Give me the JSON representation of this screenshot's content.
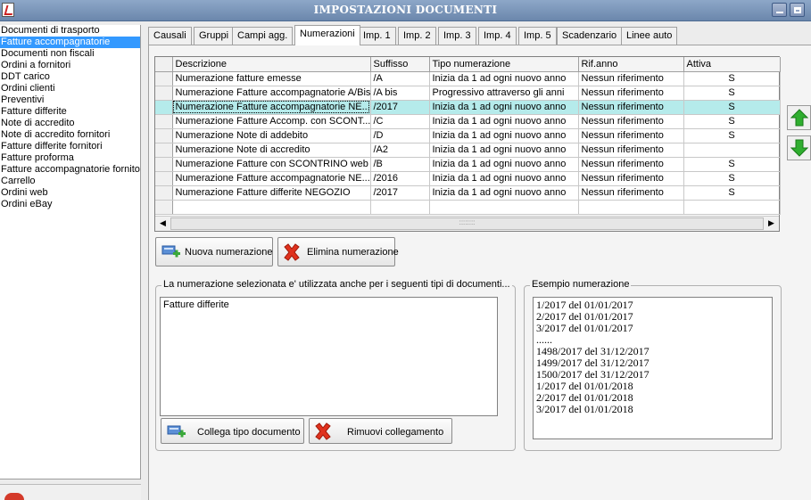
{
  "window": {
    "title": "IMPOSTAZIONI DOCUMENTI"
  },
  "sidebar": {
    "items": [
      {
        "label": "Documenti di trasporto",
        "selected": false
      },
      {
        "label": "Fatture accompagnatorie",
        "selected": true
      },
      {
        "label": "Documenti non fiscali",
        "selected": false
      },
      {
        "label": "Ordini a fornitori",
        "selected": false
      },
      {
        "label": "DDT carico",
        "selected": false
      },
      {
        "label": "Ordini clienti",
        "selected": false
      },
      {
        "label": "Preventivi",
        "selected": false
      },
      {
        "label": "Fatture differite",
        "selected": false
      },
      {
        "label": "Note di accredito",
        "selected": false
      },
      {
        "label": "Note di accredito fornitori",
        "selected": false
      },
      {
        "label": "Fatture differite fornitori",
        "selected": false
      },
      {
        "label": "Fatture proforma",
        "selected": false
      },
      {
        "label": "Fatture accompagnatorie fornito",
        "selected": false
      },
      {
        "label": "Carrello",
        "selected": false
      },
      {
        "label": "Ordini web",
        "selected": false
      },
      {
        "label": "Ordini eBay",
        "selected": false
      }
    ]
  },
  "tabs": [
    {
      "label": "Causali",
      "active": false
    },
    {
      "label": "Gruppi",
      "active": false
    },
    {
      "label": "Campi agg.",
      "active": false
    },
    {
      "label": "Numerazioni",
      "active": true
    },
    {
      "label": "Imp. 1",
      "active": false
    },
    {
      "label": "Imp. 2",
      "active": false
    },
    {
      "label": "Imp. 3",
      "active": false
    },
    {
      "label": "Imp. 4",
      "active": false
    },
    {
      "label": "Imp. 5",
      "active": false
    },
    {
      "label": "Scadenzario",
      "active": false
    },
    {
      "label": "Linee auto",
      "active": false
    }
  ],
  "grid": {
    "columns": [
      "Descrizione",
      "Suffisso",
      "Tipo numerazione",
      "Rif.anno",
      "Attiva"
    ],
    "rows": [
      {
        "desc": "Numerazione fatture emesse",
        "suffix": "/A",
        "type": "Inizia da 1 ad ogni nuovo anno",
        "rif": "Nessun riferimento",
        "active": "S",
        "selected": false
      },
      {
        "desc": "Numerazione Fatture accompagnatorie A/Bis",
        "suffix": "/A bis",
        "type": "Progressivo attraverso gli anni",
        "rif": "Nessun riferimento",
        "active": "S",
        "selected": false
      },
      {
        "desc": "Numerazione Fatture accompagnatorie NE...",
        "suffix": "/2017",
        "type": "Inizia da 1 ad ogni nuovo anno",
        "rif": "Nessun riferimento",
        "active": "S",
        "selected": true
      },
      {
        "desc": "Numerazione Fatture Accomp. con SCONT...",
        "suffix": "/C",
        "type": "Inizia da 1 ad ogni nuovo anno",
        "rif": "Nessun riferimento",
        "active": "S",
        "selected": false
      },
      {
        "desc": "Numerazione Note di addebito",
        "suffix": "/D",
        "type": "Inizia da 1 ad ogni nuovo anno",
        "rif": "Nessun riferimento",
        "active": "S",
        "selected": false
      },
      {
        "desc": "Numerazione Note di accredito",
        "suffix": "/A2",
        "type": "Inizia da 1 ad ogni nuovo anno",
        "rif": "Nessun riferimento",
        "active": "",
        "selected": false
      },
      {
        "desc": "Numerazione Fatture con SCONTRINO web",
        "suffix": "/B",
        "type": "Inizia da 1 ad ogni nuovo anno",
        "rif": "Nessun riferimento",
        "active": "S",
        "selected": false
      },
      {
        "desc": "Numerazione Fatture accompagnatorie NE...",
        "suffix": "/2016",
        "type": "Inizia da 1 ad ogni nuovo anno",
        "rif": "Nessun riferimento",
        "active": "S",
        "selected": false
      },
      {
        "desc": "Numerazione Fatture differite NEGOZIO",
        "suffix": "/2017",
        "type": "Inizia da 1 ad ogni nuovo anno",
        "rif": "Nessun riferimento",
        "active": "S",
        "selected": false
      }
    ],
    "scroll_thumb_glyph": "::::::::"
  },
  "actions": {
    "new_label": "Nuova numerazione",
    "delete_label": "Elimina numerazione"
  },
  "linked": {
    "legend": "La numerazione selezionata e' utilizzata anche per i seguenti tipi di documenti...",
    "items": [
      "Fatture differite"
    ],
    "link_label": "Collega tipo documento",
    "unlink_label": "Rimuovi collegamento"
  },
  "example": {
    "legend": "Esempio numerazione",
    "lines": [
      "1/2017 del 01/01/2017",
      "2/2017 del 01/01/2017",
      "3/2017 del 01/01/2017",
      "......",
      "1498/2017 del 31/12/2017",
      "1499/2017 del 31/12/2017",
      "1500/2017 del 31/12/2017",
      "1/2017 del 01/01/2018",
      "2/2017 del 01/01/2018",
      "3/2017 del 01/01/2018"
    ]
  },
  "colors": {
    "selection_blue": "#3399ff",
    "row_highlight": "#b5ebeb",
    "arrow_green": "#2fae2f",
    "delete_red": "#e0321e"
  }
}
